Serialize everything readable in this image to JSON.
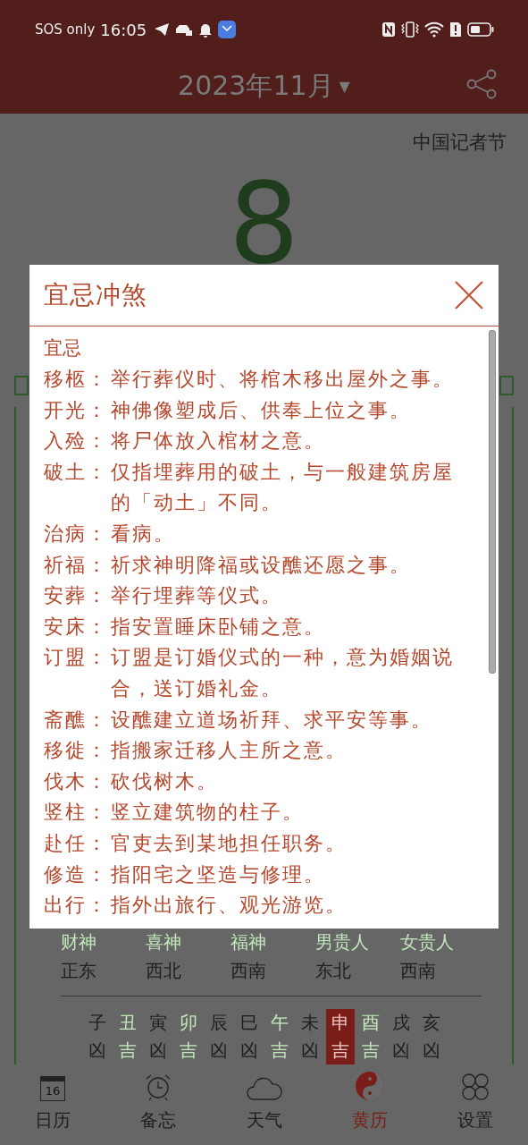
{
  "status_bar": {
    "carrier": "SOS only",
    "time": "16:05"
  },
  "header": {
    "title": "2023年11月",
    "caret": "▼"
  },
  "day": {
    "festival": "中国记者节",
    "number": "8"
  },
  "deities": [
    {
      "name": "财神",
      "direction": "正东"
    },
    {
      "name": "喜神",
      "direction": "西北"
    },
    {
      "name": "福神",
      "direction": "西南"
    },
    {
      "name": "男贵人",
      "direction": "东北"
    },
    {
      "name": "女贵人",
      "direction": "西南"
    }
  ],
  "hours": [
    {
      "branch": "子",
      "luck": "凶",
      "auspicious": false,
      "selected": false
    },
    {
      "branch": "丑",
      "luck": "吉",
      "auspicious": true,
      "selected": false
    },
    {
      "branch": "寅",
      "luck": "凶",
      "auspicious": false,
      "selected": false
    },
    {
      "branch": "卯",
      "luck": "吉",
      "auspicious": true,
      "selected": false
    },
    {
      "branch": "辰",
      "luck": "凶",
      "auspicious": false,
      "selected": false
    },
    {
      "branch": "巳",
      "luck": "凶",
      "auspicious": false,
      "selected": false
    },
    {
      "branch": "午",
      "luck": "吉",
      "auspicious": true,
      "selected": false
    },
    {
      "branch": "未",
      "luck": "凶",
      "auspicious": false,
      "selected": false
    },
    {
      "branch": "申",
      "luck": "吉",
      "auspicious": true,
      "selected": true
    },
    {
      "branch": "酉",
      "luck": "吉",
      "auspicious": true,
      "selected": false
    },
    {
      "branch": "戌",
      "luck": "凶",
      "auspicious": false,
      "selected": false
    },
    {
      "branch": "亥",
      "luck": "凶",
      "auspicious": false,
      "selected": false
    }
  ],
  "dialog": {
    "title": "宜忌冲煞",
    "section": "宜忌",
    "entries": [
      {
        "term": "移柩：",
        "definition": "举行葬仪时、将棺木移出屋外之事。"
      },
      {
        "term": "开光：",
        "definition": "神佛像塑成后、供奉上位之事。"
      },
      {
        "term": "入殓：",
        "definition": "将尸体放入棺材之意。"
      },
      {
        "term": "破土：",
        "definition": "仅指埋葬用的破土，与一般建筑房屋的「动土」不同。"
      },
      {
        "term": "治病：",
        "definition": "看病。"
      },
      {
        "term": "祈福：",
        "definition": "祈求神明降福或设醮还愿之事。"
      },
      {
        "term": "安葬：",
        "definition": "举行埋葬等仪式。"
      },
      {
        "term": "安床：",
        "definition": "指安置睡床卧铺之意。"
      },
      {
        "term": "订盟：",
        "definition": "订盟是订婚仪式的一种，意为婚姻说合，送订婚礼金。"
      },
      {
        "term": "斋醮：",
        "definition": "设醮建立道场祈拜、求平安等事。"
      },
      {
        "term": "移徙：",
        "definition": "指搬家迁移人主所之意。"
      },
      {
        "term": "伐木：",
        "definition": "砍伐树木。"
      },
      {
        "term": "竖柱：",
        "definition": "竖立建筑物的柱子。"
      },
      {
        "term": "赴任：",
        "definition": "官吏去到某地担任职务。"
      },
      {
        "term": "修造：",
        "definition": "指阳宅之坚造与修理。"
      },
      {
        "term": "出行：",
        "definition": "指外出旅行、观光游览。"
      }
    ]
  },
  "nav": [
    {
      "label": "日历",
      "icon_text": "16",
      "selected": false
    },
    {
      "label": "备忘",
      "selected": false
    },
    {
      "label": "天气",
      "selected": false
    },
    {
      "label": "黄历",
      "selected": true
    },
    {
      "label": "设置",
      "selected": false
    }
  ]
}
